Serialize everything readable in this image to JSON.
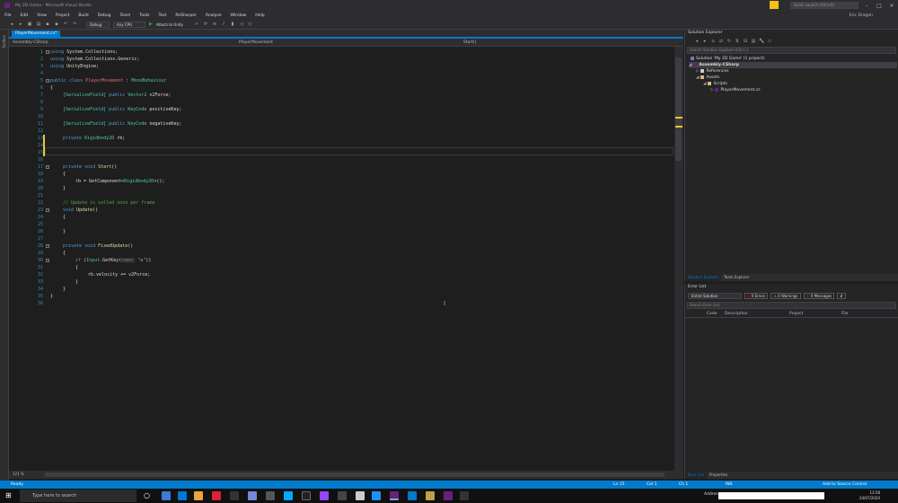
{
  "window": {
    "title": "My 2D Game - Microsoft Visual Studio",
    "quick_launch_placeholder": "Quick Launch (Ctrl+Q)",
    "user": "Eric Dragon"
  },
  "menu": [
    "File",
    "Edit",
    "View",
    "Project",
    "Build",
    "Debug",
    "Team",
    "Tools",
    "Test",
    "ReSharper",
    "Analyze",
    "Window",
    "Help"
  ],
  "toolbar": {
    "config": "Debug",
    "platform": "Any CPU",
    "attach": "Attach to Unity"
  },
  "left_strip": {
    "label": "Toolbox"
  },
  "editor": {
    "tab": "PlayerMovement.cs*",
    "nav_project": "Assembly-CSharp",
    "nav_class": "PlayerMovement",
    "nav_member": "Start()",
    "zoom": "121 %",
    "lines": [
      {
        "n": "1"
      },
      {
        "n": "2"
      },
      {
        "n": "3"
      },
      {
        "n": "4"
      },
      {
        "n": "5"
      },
      {
        "n": "6"
      },
      {
        "n": "7"
      },
      {
        "n": "8"
      },
      {
        "n": "9"
      },
      {
        "n": "10"
      },
      {
        "n": "11"
      },
      {
        "n": "12"
      },
      {
        "n": "13"
      },
      {
        "n": "14"
      },
      {
        "n": "15"
      },
      {
        "n": "16"
      },
      {
        "n": "17"
      },
      {
        "n": "18"
      },
      {
        "n": "19"
      },
      {
        "n": "20"
      },
      {
        "n": "21"
      },
      {
        "n": "22"
      },
      {
        "n": "23"
      },
      {
        "n": "24"
      },
      {
        "n": "25"
      },
      {
        "n": "26"
      },
      {
        "n": "27"
      },
      {
        "n": "28"
      },
      {
        "n": "29"
      },
      {
        "n": "30"
      },
      {
        "n": "31"
      },
      {
        "n": "32"
      },
      {
        "n": "33"
      },
      {
        "n": "34"
      },
      {
        "n": "35"
      },
      {
        "n": "36"
      }
    ],
    "code": {
      "l1_kw": "using",
      "l1_rest": " System.Collections;",
      "l2_kw": "using",
      "l2_rest": " System.Collections.Generic;",
      "l3_kw": "using",
      "l3_rest": " UnityEngine;",
      "l5_kw": "public class",
      "l5_cls": "PlayerMovement",
      "l5_sep": " : ",
      "l5_base": "MonoBehaviour",
      "l6": "{",
      "l7_attr": "[SerializeField]",
      "l7_kw": " public ",
      "l7_ty": "Vector2",
      "l7_rest": " v2Force;",
      "l9_attr": "[SerializeField]",
      "l9_kw": " public ",
      "l9_ty": "KeyCode",
      "l9_rest": " positiveKey;",
      "l11_attr": "[SerializeField]",
      "l11_kw": " public ",
      "l11_ty": "KeyCode",
      "l11_rest": " negativeKey;",
      "l13_kw": "private ",
      "l13_ty": "Rigidbody2D",
      "l13_rest": " rb;",
      "l17_kw": "private void ",
      "l17_fn": "Start",
      "l17_rest": "()",
      "l18": "{",
      "l19_a": "rb = GetComponent<",
      "l19_ty": "Rigidbody2D",
      "l19_b": ">();",
      "l20": "}",
      "l22": "// Update is called once per frame",
      "l23_kw": "void ",
      "l23_fn": "Update",
      "l23_rest": "()",
      "l24": "{",
      "l26": "}",
      "l28_kw": "private void ",
      "l28_fn": "FixedUpdate",
      "l28_rest": "()",
      "l29": "{",
      "l30_kw": "if",
      "l30_a": " (",
      "l30_ty": "Input",
      "l30_b": ".GetKey(",
      "l30_hint": "name:",
      "l30_str": " \"a\"",
      "l30_c": "))",
      "l31": "{",
      "l32": "rb.velocity += v2Force;",
      "l33": "}",
      "l34": "}",
      "l35": "}"
    }
  },
  "solution_explorer": {
    "title": "Solution Explorer",
    "search_placeholder": "Search Solution Explorer (Ctrl+;)",
    "items": [
      {
        "label": "Solution 'My 2D Game' (1 project)"
      },
      {
        "label": "Assembly-CSharp"
      },
      {
        "label": "References"
      },
      {
        "label": "Assets"
      },
      {
        "label": "Scripts"
      },
      {
        "label": "PlayerMovement.cs"
      }
    ],
    "tabs": [
      "Solution Explorer",
      "Team Explorer"
    ]
  },
  "error_list": {
    "title": "Error List",
    "scope": "Entire Solution",
    "errors": "0 Errors",
    "warnings": "0 Warnings",
    "messages": "0 Messages",
    "search_placeholder": "Search Error List",
    "columns": [
      "Code",
      "Description",
      "Project",
      "File"
    ],
    "tabs": [
      "Error List",
      "Properties"
    ]
  },
  "status": {
    "ready": "Ready",
    "line": "Ln 15",
    "col": "Col 1",
    "ch": "Ch 1",
    "mode": "INS",
    "source_control": "Add to Source Control"
  },
  "taskbar": {
    "search": "Type here to search",
    "address_label": "Address",
    "time": "13:58",
    "date": "24/07/2020"
  },
  "colors": {
    "accent": "#007acc",
    "keyword": "#569cd6",
    "type": "#4ec9b0",
    "comment": "#57a64a",
    "string": "#d69d85",
    "change_marker": "#e6c63b"
  }
}
